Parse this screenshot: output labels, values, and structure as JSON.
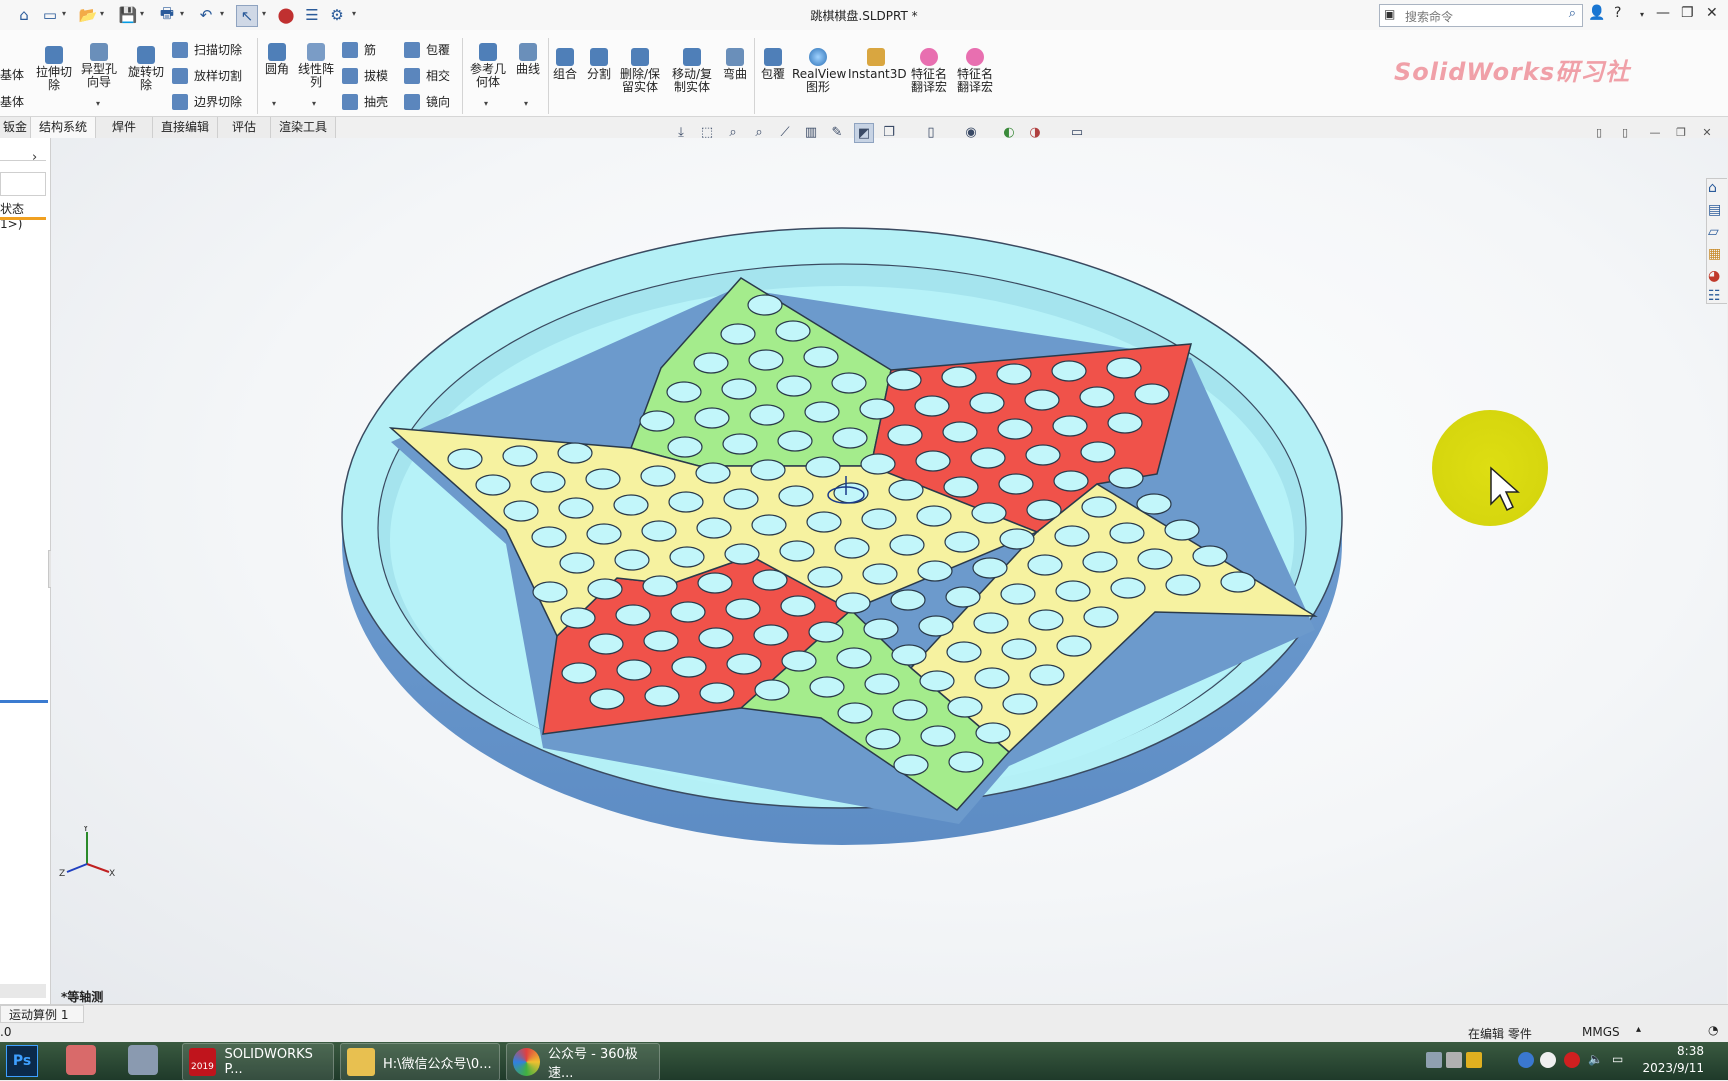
{
  "window": {
    "title": "跳棋棋盘.SLDPRT *"
  },
  "quick_access": {
    "icons": [
      "home-icon",
      "new-file-icon",
      "open-icon",
      "save-icon",
      "print-icon",
      "undo-icon",
      "select-icon",
      "rebuild-icon",
      "file-properties-icon",
      "options-icon"
    ]
  },
  "search": {
    "placeholder": "搜索命令"
  },
  "ribbon": {
    "left_partial": [
      "基体",
      "基体"
    ],
    "buttons": [
      {
        "label": "拉伸切除"
      },
      {
        "label": "异型孔向导"
      },
      {
        "label": "旋转切除"
      },
      {
        "label": "扫描切除"
      },
      {
        "label": "放样切割"
      },
      {
        "label": "边界切除"
      },
      {
        "label": "圆角"
      },
      {
        "label": "线性阵列"
      },
      {
        "label": "筋"
      },
      {
        "label": "拔模"
      },
      {
        "label": "抽壳"
      },
      {
        "label": "包覆"
      },
      {
        "label": "相交"
      },
      {
        "label": "镜向"
      },
      {
        "label": "参考几何体"
      },
      {
        "label": "曲线"
      },
      {
        "label": "组合"
      },
      {
        "label": "分割"
      },
      {
        "label": "删除/保留实体"
      },
      {
        "label": "移动/复制实体"
      },
      {
        "label": "弯曲"
      },
      {
        "label": "包覆"
      },
      {
        "label": "RealView图形"
      },
      {
        "label": "Instant3D"
      },
      {
        "label": "特征名翻译宏"
      },
      {
        "label": "特征名翻译宏"
      }
    ],
    "brand": "SolidWorks研习社"
  },
  "tabs": [
    "钣金",
    "结构系统",
    "焊件",
    "直接编辑",
    "评估",
    "渲染工具"
  ],
  "left_panel": {
    "config_text": "状态 1>)",
    "motion_tab": "运动算例 1"
  },
  "viewport": {
    "view_label": "*等轴测"
  },
  "status_bar": {
    "left": ".0",
    "editing": "在编辑 零件",
    "units": "MMGS"
  },
  "taskbar": {
    "apps": [
      {
        "label": "SOLIDWORKS P...",
        "badge": "2019"
      },
      {
        "label": "H:\\微信公众号\\0..."
      },
      {
        "label": "公众号 - 360极速..."
      }
    ],
    "time": "8:38",
    "date": "2023/9/11"
  },
  "colors": {
    "board": "#a9eef4",
    "red": "#f0524a",
    "green": "#a4ec8c",
    "yellow": "#f6f2a0",
    "cursor_halo": "#dede12"
  }
}
